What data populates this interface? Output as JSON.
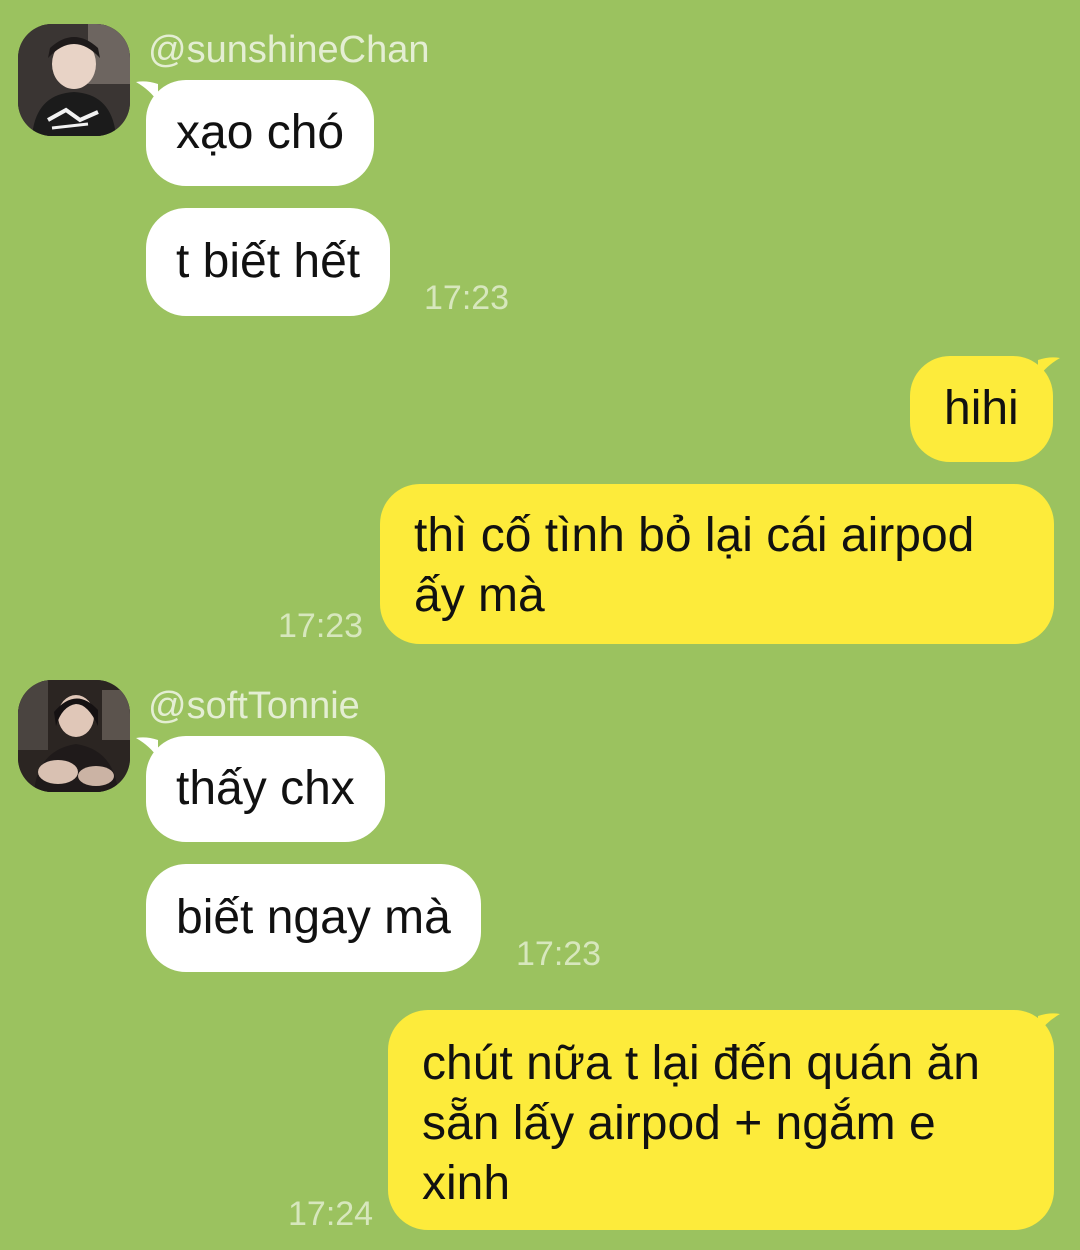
{
  "colors": {
    "background": "#9bc25f",
    "incoming_bubble": "#ffffff",
    "outgoing_bubble": "#fdeb3b",
    "username_text": "#e4eed3",
    "time_text": "#d7e7bd"
  },
  "messages": {
    "group1": {
      "username": "@sunshineChan",
      "avatar_icon": "user-avatar-icon",
      "bubbles": [
        "xạo chó",
        "t biết hết"
      ],
      "time": "17:23"
    },
    "group2": {
      "bubbles": [
        "hihi"
      ],
      "lines": [
        "thì cố tình bỏ lại cái airpod",
        "ấy mà"
      ],
      "time": "17:23"
    },
    "group3": {
      "username": "@softTonnie",
      "avatar_icon": "user-avatar-icon",
      "bubbles": [
        "thấy chx",
        "biết ngay mà"
      ],
      "time": "17:23"
    },
    "group4": {
      "lines": [
        "chút nữa t lại đến quán ăn",
        "sẵn lấy airpod + ngắm e",
        "xinh"
      ],
      "time": "17:24"
    }
  }
}
